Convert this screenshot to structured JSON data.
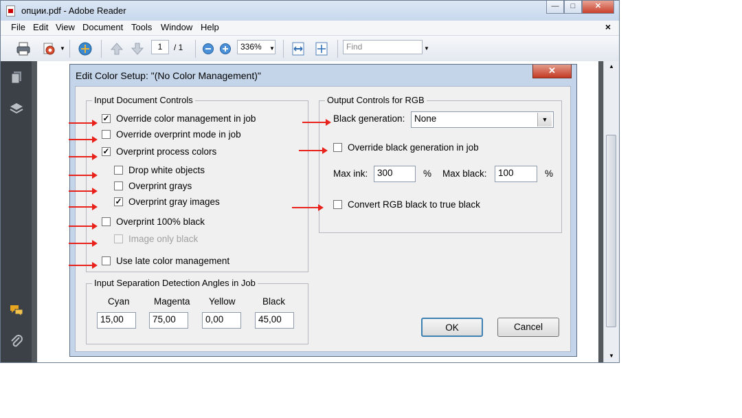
{
  "window": {
    "title": "опции.pdf - Adobe Reader",
    "buttons": {
      "minimize": "—",
      "maximize": "□",
      "close": "✕"
    }
  },
  "menubar": {
    "items": [
      "File",
      "Edit",
      "View",
      "Document",
      "Tools",
      "Window",
      "Help"
    ],
    "close_doc": "×"
  },
  "toolbar": {
    "page_current": "1",
    "page_total": "/ 1",
    "zoom": "336%",
    "find_placeholder": "Find"
  },
  "dialog": {
    "title": "Edit Color Setup: \"(No Color Management)\"",
    "close": "✕",
    "input_controls": {
      "title": "Input Document Controls",
      "items": [
        {
          "label": "Override color management in job",
          "checked": true,
          "disabled": false
        },
        {
          "label": "Override overprint mode in job",
          "checked": false,
          "disabled": false
        },
        {
          "label": "Overprint process colors",
          "checked": true,
          "disabled": false
        },
        {
          "label": "Drop white objects",
          "checked": false,
          "disabled": false
        },
        {
          "label": "Overprint grays",
          "checked": false,
          "disabled": false
        },
        {
          "label": "Overprint gray images",
          "checked": true,
          "disabled": false
        },
        {
          "label": "Overprint 100% black",
          "checked": false,
          "disabled": false
        },
        {
          "label": "Image only black",
          "checked": false,
          "disabled": true
        },
        {
          "label": "Use late color management",
          "checked": false,
          "disabled": false
        }
      ]
    },
    "separation": {
      "title": "Input Separation Detection Angles in Job",
      "columns": [
        "Cyan",
        "Magenta",
        "Yellow",
        "Black"
      ],
      "values": [
        "15,00",
        "75,00",
        "0,00",
        "45,00"
      ]
    },
    "output_rgb": {
      "title": "Output Controls for RGB",
      "black_generation_label": "Black generation:",
      "black_generation_value": "None",
      "override_black_label": "Override black generation in job",
      "override_black_checked": false,
      "max_ink_label": "Max ink:",
      "max_ink_value": "300",
      "max_black_label": "Max black:",
      "max_black_value": "100",
      "percent": "%",
      "convert_rgb_label": "Convert RGB black to true black",
      "convert_rgb_checked": false
    },
    "buttons": {
      "ok": "OK",
      "cancel": "Cancel"
    }
  },
  "colors": {
    "annotation_arrow": "#e8221b",
    "dialog_frame": "#c4d5ea"
  },
  "icons": [
    "print-icon",
    "share-icon",
    "collaborate-icon",
    "prev-page-icon",
    "next-page-icon",
    "zoom-out-icon",
    "zoom-in-icon",
    "fit-width-icon",
    "fit-page-icon",
    "pages-icon",
    "layers-icon",
    "comments-icon",
    "attachments-icon"
  ]
}
